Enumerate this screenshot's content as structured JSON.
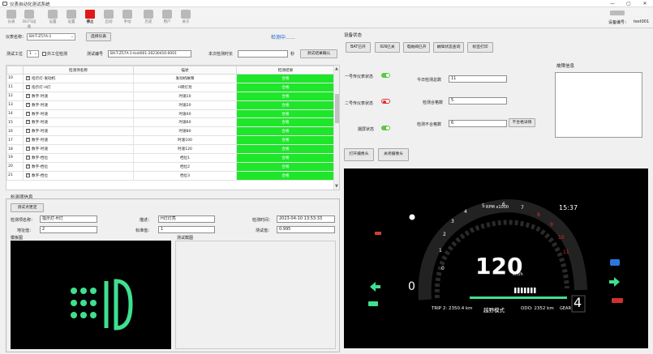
{
  "window": {
    "title": "仪表自动化测试系统"
  },
  "toolbar": {
    "items": [
      {
        "label": "仪表"
      },
      {
        "label": "DUTS设备"
      },
      {
        "label": "设置"
      },
      {
        "label": "设置"
      },
      {
        "label": "停止"
      },
      {
        "label": "启动"
      },
      {
        "label": "手动"
      },
      {
        "label": "历史"
      },
      {
        "label": "用户"
      },
      {
        "label": "关于"
      }
    ],
    "device_code_label": "设备编号：",
    "device_code": "test001"
  },
  "top": {
    "meter_name_label": "仪表名称：",
    "meter_name": "BX-T-Z57A-1",
    "select_meter_button": "选择仪表",
    "status": "检测中……",
    "station_label": "测试工位",
    "station_value": "1",
    "external_label": "外工位检测",
    "test_no_label": "测试编号",
    "test_no": "BX-T-Z57A-1-test001-20230410-0001",
    "duration_label": "本次检测时长",
    "duration_unit": "秒",
    "confirm_button": "测试结果确认"
  },
  "table": {
    "headers": [
      "",
      "检测项名称",
      "描述",
      "检测结果"
    ],
    "rows": [
      {
        "no": "10",
        "checked": true,
        "name": "指示灯-发动机",
        "desc": "发动机故障",
        "result": "合格"
      },
      {
        "no": "11",
        "checked": true,
        "name": "指示灯-H灯",
        "desc": "H转灯亮",
        "result": "合格"
      },
      {
        "no": "12",
        "checked": true,
        "name": "数字-时速",
        "desc": "时速10",
        "result": "合格"
      },
      {
        "no": "13",
        "checked": true,
        "name": "数字-时速",
        "desc": "时速20",
        "result": "合格"
      },
      {
        "no": "14",
        "checked": true,
        "name": "数字-时速",
        "desc": "时速40",
        "result": "合格"
      },
      {
        "no": "15",
        "checked": true,
        "name": "数字-时速",
        "desc": "时速60",
        "result": "合格"
      },
      {
        "no": "16",
        "checked": true,
        "name": "数字-时速",
        "desc": "时速80",
        "result": "合格"
      },
      {
        "no": "17",
        "checked": true,
        "name": "数字-时速",
        "desc": "时速100",
        "result": "合格"
      },
      {
        "no": "18",
        "checked": true,
        "name": "数字-时速",
        "desc": "时速120",
        "result": "合格"
      },
      {
        "no": "19",
        "checked": true,
        "name": "数字-档位",
        "desc": "档位1",
        "result": "合格"
      },
      {
        "no": "20",
        "checked": true,
        "name": "数字-档位",
        "desc": "档位2",
        "result": "合格"
      },
      {
        "no": "21",
        "checked": true,
        "name": "数字-档位",
        "desc": "档位3",
        "result": "合格"
      }
    ]
  },
  "detail": {
    "section_title": "检测项信息",
    "test_point_button": "测试点更定",
    "name_label": "检测项名称：",
    "name_value": "指示灯-H灯",
    "desc_label": "描述：",
    "desc_value": "H灯灯亮",
    "time_label": "检测时间：",
    "time_value": "2023-04-10 13:53:33",
    "addr_label": "地址值：",
    "addr_value": "2",
    "std_label": "标准值：",
    "std_value": "1",
    "measured_label": "测试值：",
    "measured_value": "0.995",
    "template_label": "模板图",
    "test_image_label": "测试截图"
  },
  "device": {
    "section_title": "设备状态",
    "buttons": [
      "BAT已开",
      "IGN已关",
      "电磁阀已开",
      "故障状态查询",
      "标签打印"
    ],
    "fault_title": "故障信息",
    "status_items": [
      {
        "label": "一号传仪表状态",
        "state": "on"
      },
      {
        "label": "二号传仪表状态",
        "state": "off"
      },
      {
        "label": "摄屏状态",
        "state": "on"
      }
    ],
    "today_label": "今日检测总数",
    "today_value": "11",
    "pass_label": "检测合格数",
    "pass_value": "5",
    "fail_label": "检测不合格数",
    "fail_value": "6",
    "fail_detail_button": "不合格详情",
    "open_camera_button": "打开摄像头",
    "close_camera_button": "关闭摄像头"
  },
  "dashboard": {
    "rpm_label": "RPM x1000",
    "clock": "15:37",
    "tach_numbers": [
      "0",
      "1",
      "2",
      "3",
      "4",
      "5",
      "6",
      "7",
      "8",
      "9",
      "10",
      "11"
    ],
    "speed": "120",
    "speed_unit": "km/h",
    "gear_left": "0",
    "trip": "TRIP 2: 2350.4 km",
    "mode": "越野模式",
    "odo": "ODO: 2352 km",
    "gear_label": "GEAR",
    "gear_value": "4"
  },
  "colors": {
    "pass_green": "#1ee62a",
    "stop_red": "#e01818",
    "status_blue": "#1a63c9",
    "dash_green": "#2fdb85"
  }
}
